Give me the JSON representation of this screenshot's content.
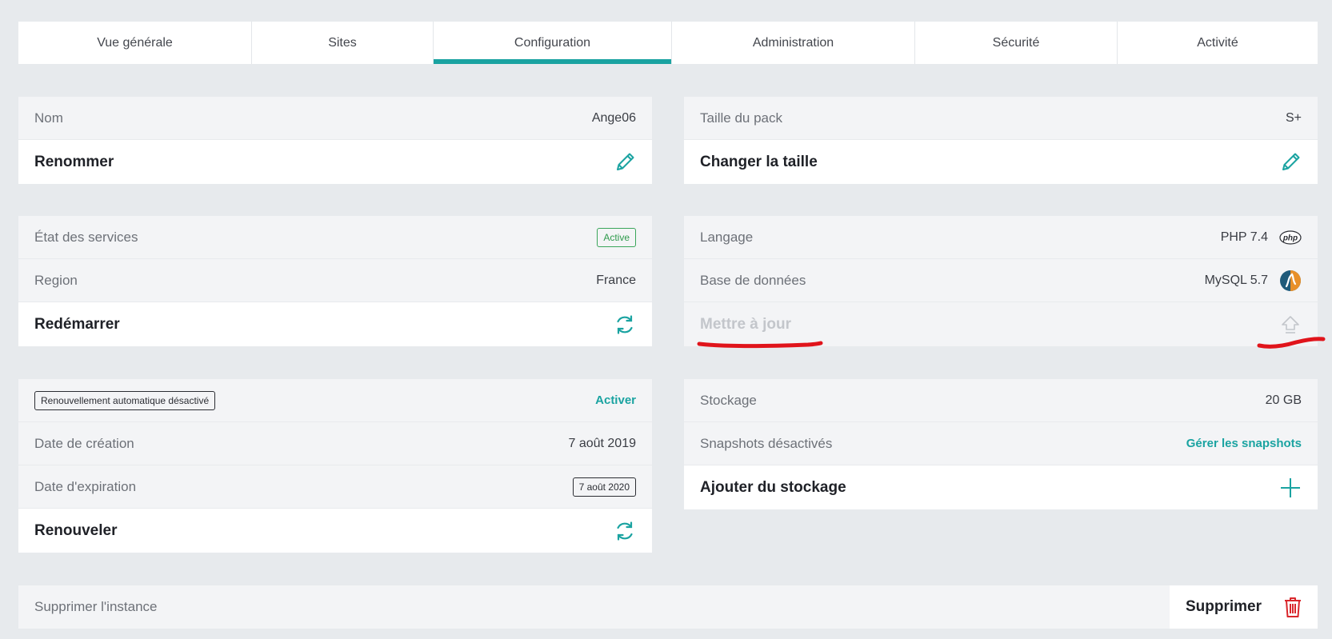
{
  "tabs": [
    {
      "label": "Vue générale",
      "active": false
    },
    {
      "label": "Sites",
      "active": false
    },
    {
      "label": "Configuration",
      "active": true
    },
    {
      "label": "Administration",
      "active": false
    },
    {
      "label": "Sécurité",
      "active": false
    },
    {
      "label": "Activité",
      "active": false
    }
  ],
  "name_card": {
    "name_label": "Nom",
    "name_value": "Ange06",
    "rename_label": "Renommer",
    "rename_icon": "pencil-icon"
  },
  "services_card": {
    "status_label": "État des services",
    "status_badge": "Active",
    "region_label": "Region",
    "region_value": "France",
    "restart_label": "Redémarrer",
    "restart_icon": "refresh-icon"
  },
  "renewal_card": {
    "auto_renew_badge": "Renouvellement automatique désactivé",
    "activate_link": "Activer",
    "created_label": "Date de création",
    "created_value": "7 août 2019",
    "expiry_label": "Date d'expiration",
    "expiry_value": "7 août 2020",
    "renew_label": "Renouveler",
    "renew_icon": "refresh-icon"
  },
  "pack_card": {
    "size_label": "Taille du pack",
    "size_value": "S+",
    "change_label": "Changer la taille",
    "change_icon": "pencil-icon"
  },
  "stack_card": {
    "language_label": "Langage",
    "language_value": "PHP 7.4",
    "language_icon": "php-logo-icon",
    "php_logo_text": "php",
    "database_label": "Base de données",
    "database_value": "MySQL 5.7",
    "database_icon": "mysql-logo-icon",
    "update_label": "Mettre à jour",
    "update_icon": "upload-arrow-icon"
  },
  "storage_card": {
    "storage_label": "Stockage",
    "storage_value": "20 GB",
    "snapshots_label": "Snapshots désactivés",
    "snapshots_link": "Gérer les snapshots",
    "add_storage_label": "Ajouter du stockage",
    "add_icon": "plus-icon"
  },
  "delete_row": {
    "label": "Supprimer l'instance",
    "button_label": "Supprimer",
    "button_icon": "trash-icon"
  },
  "colors": {
    "accent": "#1aa3a1",
    "danger": "#d9262b",
    "annotation": "#e0141b",
    "background": "#e7eaed"
  }
}
